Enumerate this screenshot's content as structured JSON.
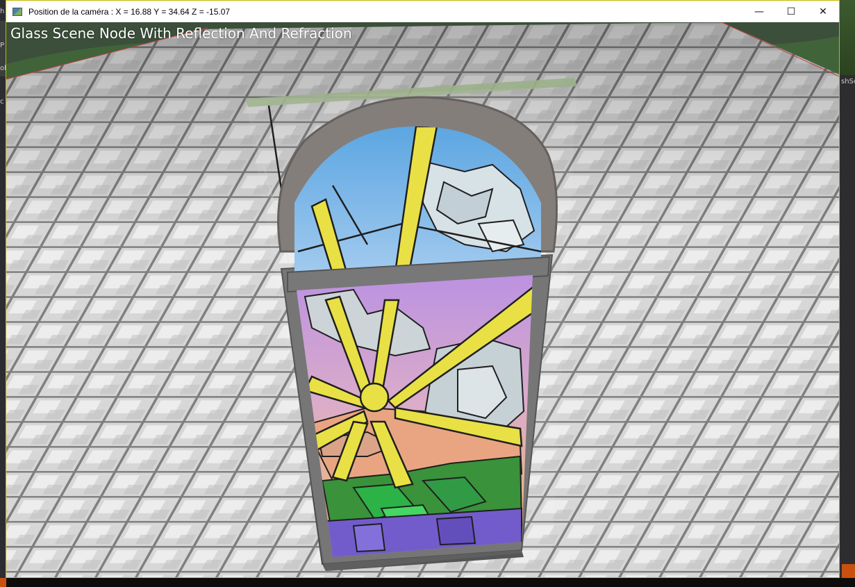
{
  "window": {
    "title": "Position de la caméra : X = 16.88 Y = 34.64 Z = -15.07",
    "minimize_glyph": "—",
    "maximize_glyph": "☐",
    "close_glyph": "✕"
  },
  "scene": {
    "title": "Glass Scene Node With Reflection And Refraction"
  },
  "background_fragments": {
    "left_1": "h",
    "left_2": "P",
    "left_3": "ol",
    "left_4": "c",
    "right_1": "shSc"
  },
  "colors": {
    "title_bar": "#ffffff",
    "window_border": "#c8b400",
    "sky_glass": "#6aaee6",
    "sun_yellow": "#e8df3a",
    "lead_lines": "#111111",
    "hills_green": "#2e8c2e",
    "base_purple": "#6a52c8",
    "frame_grey": "#6e6e6e",
    "tile_light": "#e6e6e6",
    "tile_grout": "#7a7a7a"
  },
  "icons": {
    "app": "app-window-icon",
    "minimize": "minimize-icon",
    "maximize": "maximize-icon",
    "close": "close-icon"
  }
}
